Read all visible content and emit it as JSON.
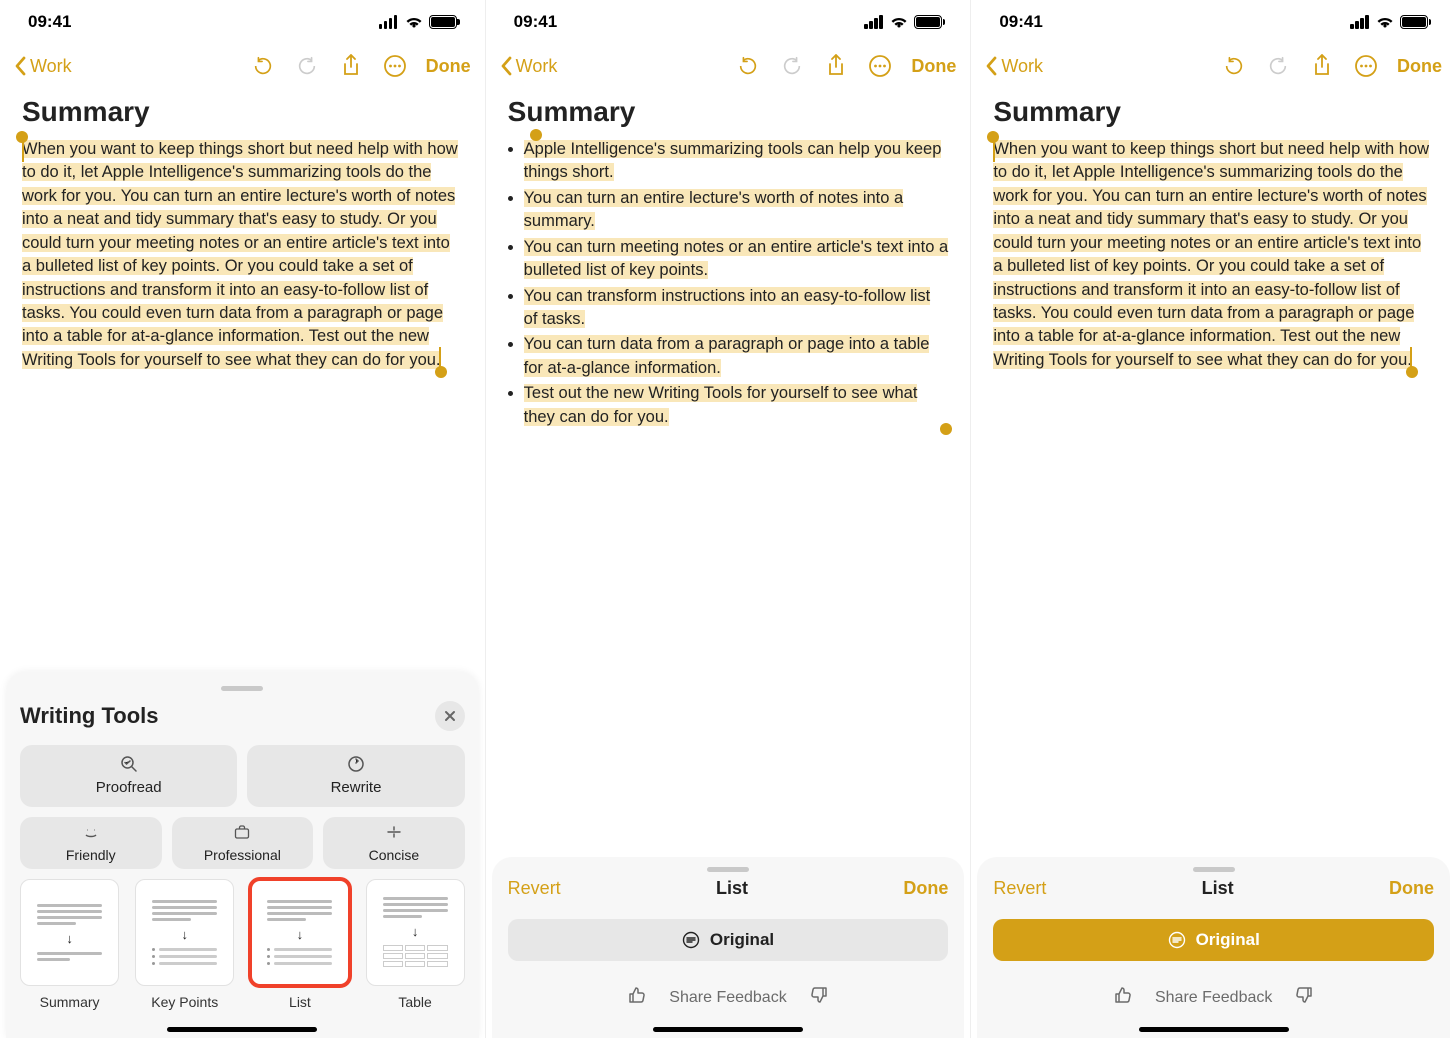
{
  "status": {
    "time": "09:41"
  },
  "nav": {
    "back_label": "Work",
    "done_label": "Done"
  },
  "note": {
    "title": "Summary",
    "paragraph": "When you want to keep things short but need help with how to do it, let Apple Intelligence's summarizing tools do the work for you. You can turn an entire lecture's worth of notes into a neat and tidy summary that's easy to study. Or you could turn your meeting notes or an entire article's text into a bulleted list of key points. Or you could take a set of instructions and transform it into an easy-to-follow list of tasks. You could even turn data from a paragraph or page into a table for at-a-glance information. Test out the new Writing Tools for yourself to see what they can do for you."
  },
  "list_points": [
    "Apple Intelligence's summarizing tools can help you keep things short.",
    "You can turn an entire lecture's worth of notes into a summary.",
    "You can turn meeting notes or an entire article's text into a bulleted list of key points.",
    "You can transform instructions into an easy-to-follow list of tasks.",
    "You can turn data from a paragraph or page into a table for at-a-glance information.",
    "Test out the new Writing Tools for yourself to see what they can do for you."
  ],
  "writing_tools": {
    "title": "Writing Tools",
    "proofread": "Proofread",
    "rewrite": "Rewrite",
    "friendly": "Friendly",
    "professional": "Professional",
    "concise": "Concise",
    "transforms": {
      "summary": "Summary",
      "key_points": "Key Points",
      "list": "List",
      "table": "Table"
    },
    "selected_transform": "list"
  },
  "result_sheet": {
    "revert": "Revert",
    "title": "List",
    "done": "Done",
    "original": "Original",
    "feedback": "Share Feedback"
  }
}
